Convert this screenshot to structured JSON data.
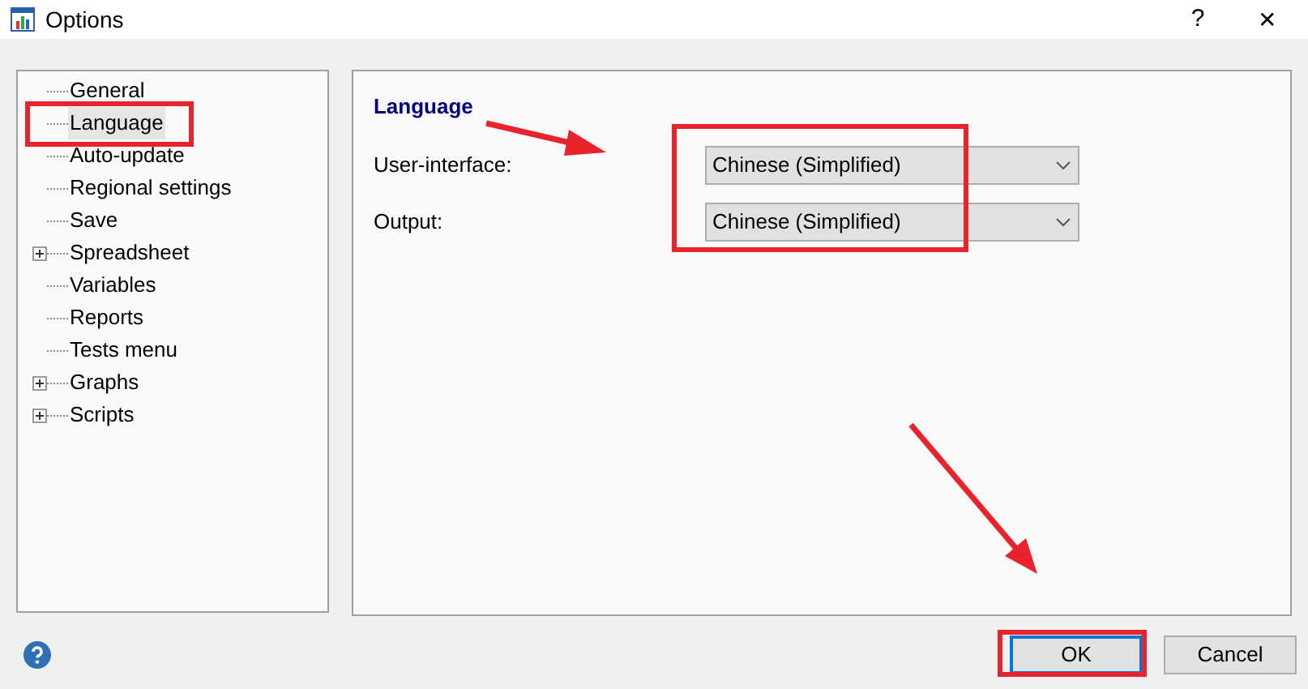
{
  "window": {
    "title": "Options",
    "help_glyph": "?",
    "close_glyph": "✕"
  },
  "tree": [
    {
      "label": "General",
      "selected": false,
      "expandable": false
    },
    {
      "label": "Language",
      "selected": true,
      "expandable": false
    },
    {
      "label": "Auto-update",
      "selected": false,
      "expandable": false
    },
    {
      "label": "Regional settings",
      "selected": false,
      "expandable": false
    },
    {
      "label": "Save",
      "selected": false,
      "expandable": false
    },
    {
      "label": "Spreadsheet",
      "selected": false,
      "expandable": true
    },
    {
      "label": "Variables",
      "selected": false,
      "expandable": false
    },
    {
      "label": "Reports",
      "selected": false,
      "expandable": false
    },
    {
      "label": "Tests menu",
      "selected": false,
      "expandable": false
    },
    {
      "label": "Graphs",
      "selected": false,
      "expandable": true
    },
    {
      "label": "Scripts",
      "selected": false,
      "expandable": true
    }
  ],
  "panel": {
    "heading": "Language",
    "fields": [
      {
        "label": "User-interface:",
        "value": "Chinese (Simplified)"
      },
      {
        "label": "Output:",
        "value": "Chinese (Simplified)"
      }
    ]
  },
  "buttons": [
    {
      "label": "OK",
      "default": true
    },
    {
      "label": "Cancel",
      "default": false
    }
  ]
}
